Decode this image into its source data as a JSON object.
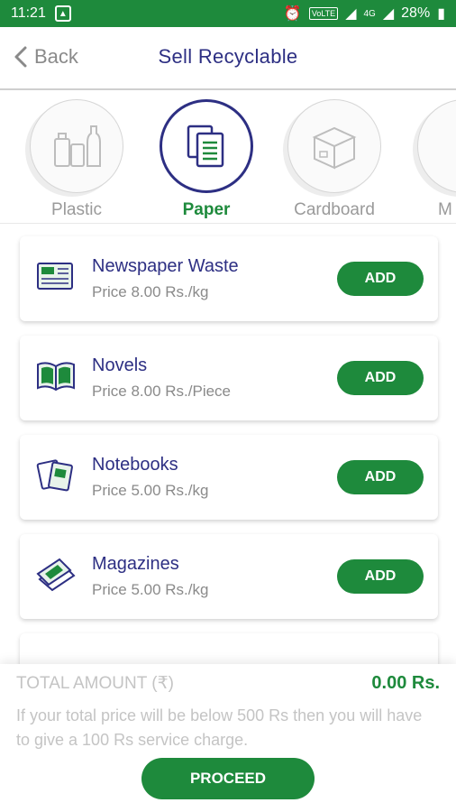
{
  "status_bar": {
    "time": "11:21",
    "network": "VoLTE",
    "data": "4G",
    "battery": "28%"
  },
  "header": {
    "back_label": "Back",
    "title": "Sell Recyclable"
  },
  "categories": [
    {
      "label": "Plastic",
      "icon": "plastic-bottles-icon",
      "active": false
    },
    {
      "label": "Paper",
      "icon": "paper-document-icon",
      "active": true
    },
    {
      "label": "Cardboard",
      "icon": "cardboard-box-icon",
      "active": false
    },
    {
      "label": "M",
      "icon": "partial-category-icon",
      "active": false
    }
  ],
  "items": [
    {
      "name": "Newspaper Waste",
      "price": "Price 8.00 Rs./kg",
      "button": "ADD",
      "icon": "newspaper-icon"
    },
    {
      "name": "Novels",
      "price": "Price 8.00 Rs./Piece",
      "button": "ADD",
      "icon": "open-book-icon"
    },
    {
      "name": "Notebooks",
      "price": "Price 5.00 Rs./kg",
      "button": "ADD",
      "icon": "notebooks-icon"
    },
    {
      "name": "Magazines",
      "price": "Price 5.00 Rs./kg",
      "button": "ADD",
      "icon": "magazines-icon"
    }
  ],
  "footer": {
    "total_label": "TOTAL AMOUNT (₹)",
    "total_value": "0.00 Rs.",
    "note": "If your total price will be below 500 Rs then you will have to give a 100 Rs service charge.",
    "proceed_label": "PROCEED"
  },
  "colors": {
    "accent_green": "#1e8a3c",
    "title_blue": "#2d2f83",
    "muted_gray": "#8a8a8a"
  }
}
